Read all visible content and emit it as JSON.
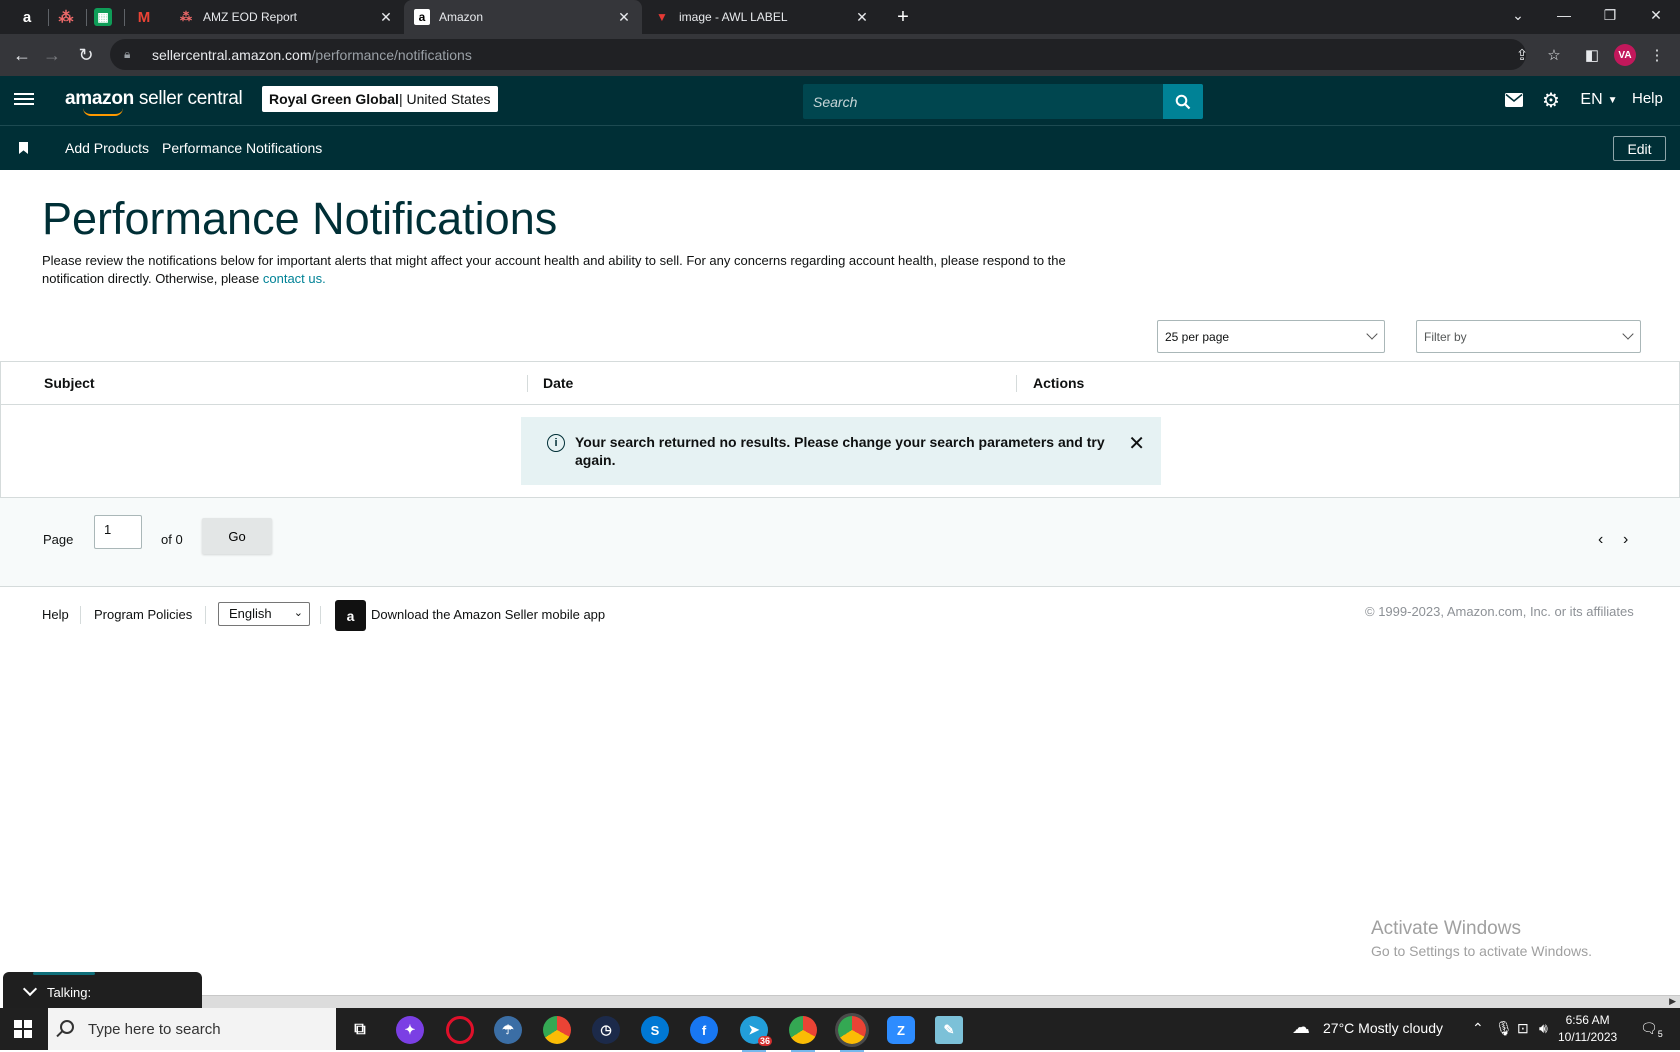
{
  "browser": {
    "pinned_tabs": [
      {
        "name": "amazon-pinned",
        "glyph": "a"
      },
      {
        "name": "asana-pinned",
        "glyph": "⁂"
      },
      {
        "name": "sheets-pinned",
        "glyph": "▦"
      },
      {
        "name": "gmail-pinned",
        "glyph": "M"
      }
    ],
    "tabs": [
      {
        "title": "AMZ EOD Report",
        "icon": "asana-icon"
      },
      {
        "title": "Amazon",
        "icon": "amazon-icon"
      },
      {
        "title": "image - AWL LABEL",
        "icon": "fl-icon"
      }
    ],
    "url_host": "sellercentral.amazon.com",
    "url_path": "/performance/notifications",
    "profile_initials": "VA"
  },
  "header": {
    "logo_main": "amazon",
    "logo_sub": " seller central",
    "account_name": "Royal Green Global",
    "account_region": " | United States",
    "search_placeholder": "Search",
    "language": "EN",
    "help": "Help"
  },
  "subnav": {
    "items": [
      "Add Products",
      "Performance Notifications"
    ],
    "edit": "Edit"
  },
  "main": {
    "title": "Performance Notifications",
    "description": "Please review the notifications below for important alerts that might affect your account health and ability to sell. For any concerns regarding account health, please respond to the notification directly. Otherwise, please ",
    "contact_link": "contact us.",
    "per_page": "25 per page",
    "filter_by": "Filter by",
    "columns": [
      "Subject",
      "Date",
      "Actions"
    ],
    "alert_message": "Your search returned no results. Please change your search parameters and try again."
  },
  "pager": {
    "page_label": "Page",
    "page_value": "1",
    "of_label": "of 0",
    "go": "Go"
  },
  "footer": {
    "help": "Help",
    "policies": "Program Policies",
    "language": "English",
    "app_text": "Download the Amazon Seller mobile app",
    "copyright": "© 1999-2023, Amazon.com, Inc. or its affiliates"
  },
  "os": {
    "watermark_title": "Activate Windows",
    "watermark_sub": "Go to Settings to activate Windows.",
    "talking": "Talking:",
    "search_placeholder": "Type here to search",
    "weather": "27°C  Mostly cloudy",
    "time": "6:56 AM",
    "date": "10/11/2023",
    "notif_count": "5",
    "badge_telegram": "36"
  },
  "colors": {
    "header_bg": "#002f36",
    "accent": "#008296",
    "alert_bg": "#e6f2f3"
  }
}
